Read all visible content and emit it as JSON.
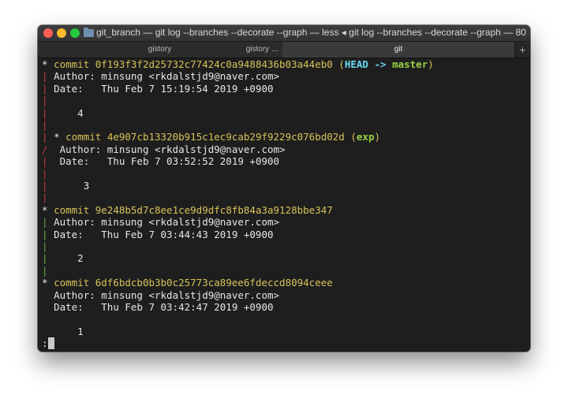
{
  "window": {
    "title": "git_branch — git log --branches --decorate --graph — less ◂ git log --branches --decorate --graph — 80..."
  },
  "tabs": [
    {
      "label": "gistory"
    },
    {
      "label": "gistory ..."
    },
    {
      "label": "git"
    }
  ],
  "new_tab_label": "+",
  "log": {
    "c1": {
      "star": "*",
      "prefix": "commit ",
      "hash": "0f193f3f2d25732c77424c0a9488436b03a44eb0",
      "open": " (",
      "head": "HEAD -> ",
      "branch": "master",
      "close": ")",
      "author": "Author: minsung <rkdalstjd9@naver.com>",
      "date": "Date:   Thu Feb 7 15:19:54 2019 +0900",
      "message": "4"
    },
    "c2": {
      "star": "*",
      "prefix": "commit ",
      "hash": "4e907cb13320b915c1ec9cab29f9229c076bd02d",
      "open": " (",
      "branch": "exp",
      "close": ")",
      "author": "Author: minsung <rkdalstjd9@naver.com>",
      "date": "Date:   Thu Feb 7 03:52:52 2019 +0900",
      "message": "3"
    },
    "c3": {
      "star": "*",
      "prefix": "commit ",
      "hash": "9e248b5d7c8ee1ce9d9dfc8fb84a3a9128bbe347",
      "author": "Author: minsung <rkdalstjd9@naver.com>",
      "date": "Date:   Thu Feb 7 03:44:43 2019 +0900",
      "message": "2"
    },
    "c4": {
      "star": "*",
      "prefix": "commit ",
      "hash": "6df6bdcb0b3b0c25773ca89ee6fdeccd8094ceee",
      "author": "Author: minsung <rkdalstjd9@naver.com>",
      "date": "Date:   Thu Feb 7 03:42:47 2019 +0900",
      "message": "1"
    },
    "graph": {
      "pipe": "|",
      "slash": "/"
    },
    "prompt": ":"
  },
  "colors": {
    "hash": "#d7c35a",
    "head": "#67d8ef",
    "branch": "#9bd045",
    "graph_red": "#c83b3b",
    "graph_green": "#5fb13f"
  }
}
